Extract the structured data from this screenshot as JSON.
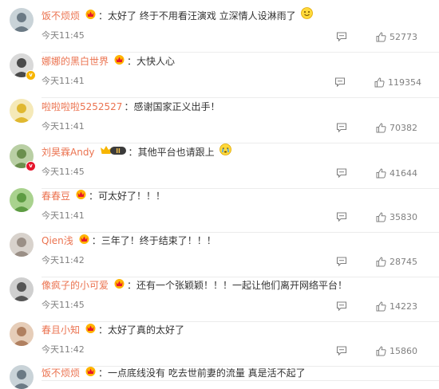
{
  "comments": [
    {
      "username": "饭不烦烦",
      "text": "太好了 终于不用看汪演戏 立深情人设淋雨了",
      "emoji": "smile",
      "time": "今天11:45",
      "likes": "52773",
      "avatar_color": "#6b7a85",
      "avatar_bg": "#c9d3d8",
      "verified": "none",
      "badge": "crown"
    },
    {
      "username": "娜娜的黑白世界",
      "text": "大快人心",
      "emoji": "",
      "time": "今天11:41",
      "likes": "119354",
      "avatar_color": "#4a4a4a",
      "avatar_bg": "#d9d9d9",
      "verified": "gold",
      "badge": "crown"
    },
    {
      "username": "啦啦啦啦5252527",
      "text": "感谢国家正义出手！",
      "emoji": "",
      "time": "今天11:41",
      "likes": "70382",
      "avatar_color": "#e0b830",
      "avatar_bg": "#f5e9b8",
      "verified": "none",
      "badge": "none"
    },
    {
      "username": "刘昊霖Andy",
      "text": "其他平台也请跟上",
      "emoji": "cry",
      "time": "今天11:45",
      "likes": "41644",
      "avatar_color": "#6b8f4e",
      "avatar_bg": "#b9cfa4",
      "verified": "red",
      "badge": "vip"
    },
    {
      "username": "春春豆",
      "text": "可太好了！！！",
      "emoji": "",
      "time": "今天11:41",
      "likes": "35830",
      "avatar_color": "#5e9c43",
      "avatar_bg": "#a9d28e",
      "verified": "none",
      "badge": "crown"
    },
    {
      "username": "Qien浅",
      "text": "三年了！终于结束了！！！",
      "emoji": "",
      "time": "今天11:42",
      "likes": "28745",
      "avatar_color": "#9a8f86",
      "avatar_bg": "#d8d2cc",
      "verified": "none",
      "badge": "crown"
    },
    {
      "username": "像疯子的小可爱",
      "text": "还有一个张颖颖！！！一起让他们离开网络平台！",
      "emoji": "",
      "time": "今天11:45",
      "likes": "14223",
      "avatar_color": "#555555",
      "avatar_bg": "#cfcfcf",
      "verified": "none",
      "badge": "crown"
    },
    {
      "username": "春且小知",
      "text": "太好了真的太好了",
      "emoji": "",
      "time": "今天11:42",
      "likes": "15860",
      "avatar_color": "#b08060",
      "avatar_bg": "#e6cdb8",
      "verified": "none",
      "badge": "crown"
    },
    {
      "username": "饭不烦烦",
      "text": "一点底线没有 吃去世前妻的流量 真是活不起了",
      "emoji": "",
      "time": "",
      "likes": "",
      "avatar_color": "#6b7a85",
      "avatar_bg": "#c9d3d8",
      "verified": "none",
      "badge": "crown"
    }
  ],
  "colors": {
    "username": "#eb7350",
    "meta": "#808080",
    "text": "#333333"
  },
  "icons": {
    "comment": "comment-icon",
    "like": "thumbs-up-icon",
    "crown": "crown-badge-icon",
    "vip": "vip-badge-icon"
  }
}
